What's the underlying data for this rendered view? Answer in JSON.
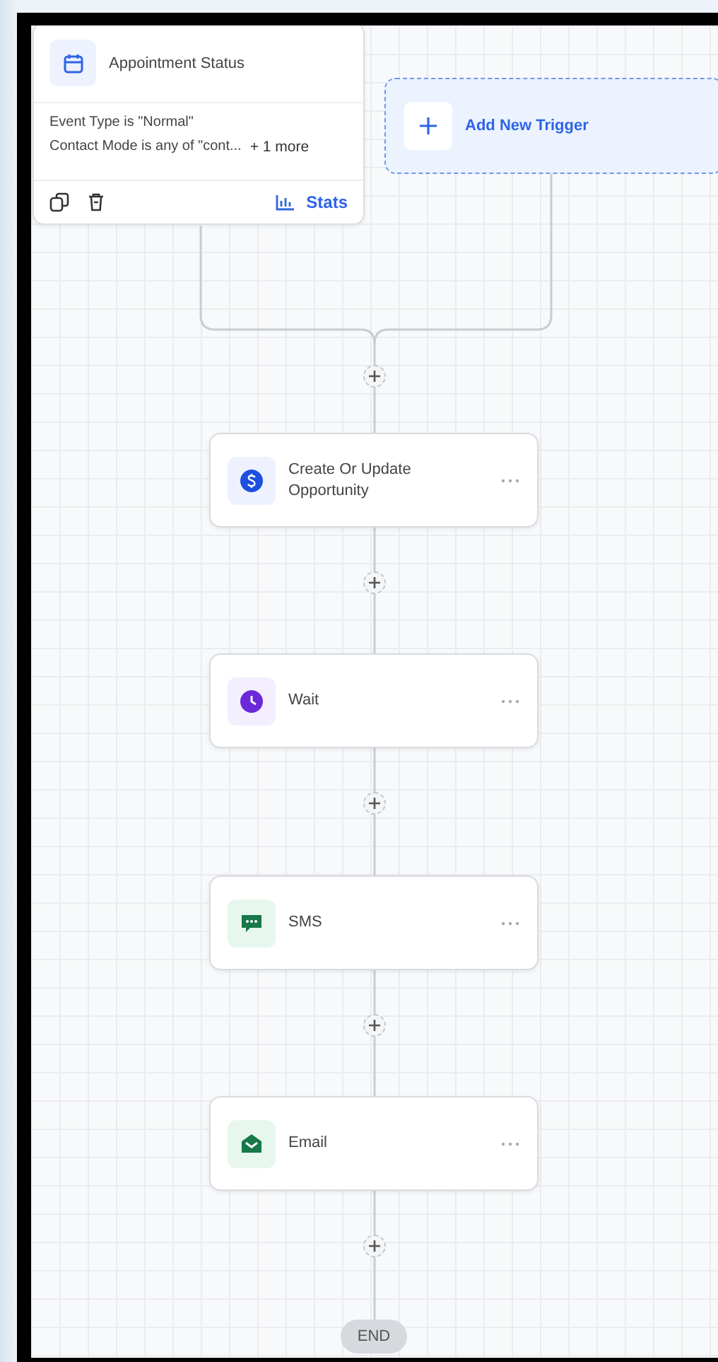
{
  "trigger": {
    "title": "Appointment Status",
    "conditions": [
      "Event Type is \"Normal\"",
      "Contact Mode is any of \"cont..."
    ],
    "more": "+ 1 more",
    "stats": "Stats"
  },
  "add_trigger": {
    "label": "Add New Trigger"
  },
  "actions": [
    {
      "kind": "opportunity",
      "title": "Create Or Update Opportunity"
    },
    {
      "kind": "wait",
      "title": "Wait"
    },
    {
      "kind": "sms",
      "title": "SMS"
    },
    {
      "kind": "email",
      "title": "Email"
    }
  ],
  "end": "END"
}
